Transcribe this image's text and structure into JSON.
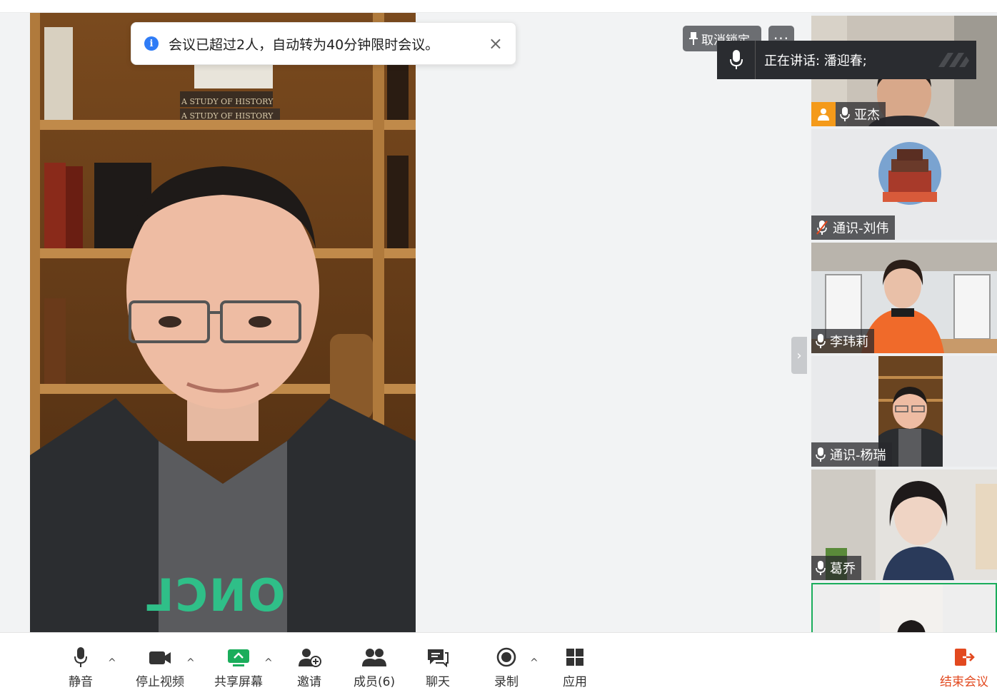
{
  "notice": {
    "message": "会议已超过2人，自动转为40分钟限时会议。",
    "close": "×"
  },
  "pin_button": {
    "label": "取消锁定"
  },
  "more_button": {
    "label": "···"
  },
  "speaking": {
    "label": "正在讲话:  潘迎春;"
  },
  "main_video": {
    "shirt_text": "ONCL",
    "book_text_1": "A STUDY OF HISTORY",
    "book_text_2": "A STUDY OF HISTORY"
  },
  "participants": [
    {
      "name": "亚杰",
      "host": true,
      "muted": false
    },
    {
      "name": "通识-刘伟",
      "host": false,
      "muted": true
    },
    {
      "name": "李玮莉",
      "host": false,
      "muted": false
    },
    {
      "name": "通识-杨瑞",
      "host": false,
      "muted": false
    },
    {
      "name": "葛乔",
      "host": false,
      "muted": false
    }
  ],
  "toolbar": {
    "mute": "静音",
    "stop_video": "停止视频",
    "share_screen": "共享屏幕",
    "invite": "邀请",
    "members": "成员(6)",
    "chat": "聊天",
    "record": "录制",
    "apps": "应用",
    "end_meeting": "结束会议",
    "caret": "^"
  },
  "colors": {
    "accent_green": "#1aad5b",
    "end_red": "#e2491f",
    "host_orange": "#f49a1a",
    "info_blue": "#2f7cf6"
  }
}
